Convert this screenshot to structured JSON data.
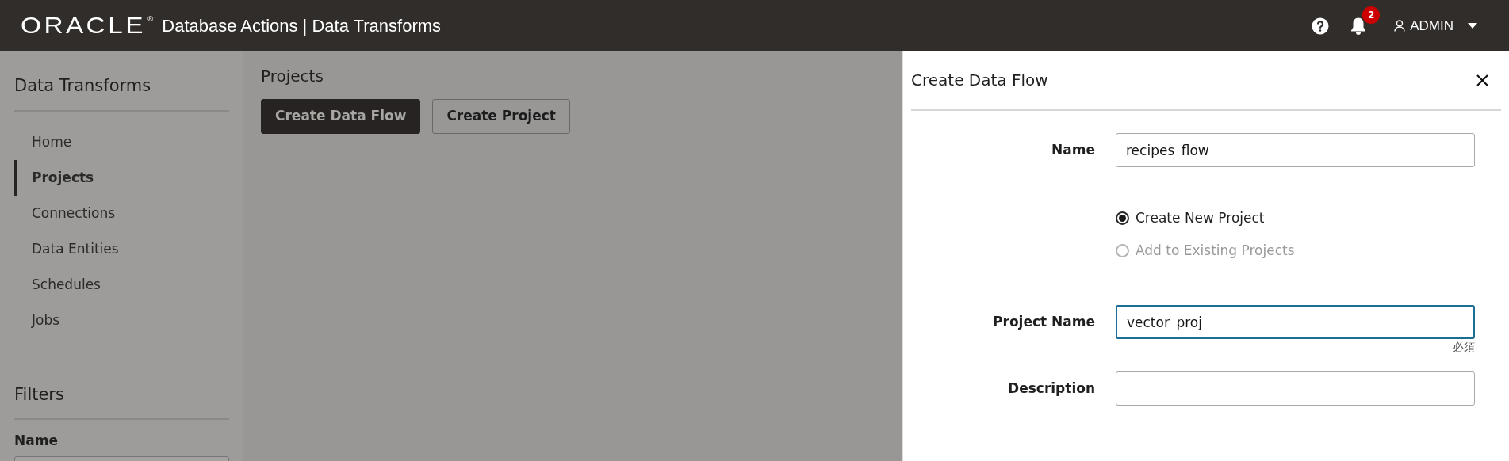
{
  "header": {
    "logo": "ORACLE",
    "logo_mark": "®",
    "title": "Database Actions | Data Transforms",
    "notification_count": "2",
    "user": "ADMIN"
  },
  "sidebar": {
    "title": "Data Transforms",
    "items": [
      {
        "label": "Home",
        "selected": false
      },
      {
        "label": "Projects",
        "selected": true
      },
      {
        "label": "Connections",
        "selected": false
      },
      {
        "label": "Data Entities",
        "selected": false
      },
      {
        "label": "Schedules",
        "selected": false
      },
      {
        "label": "Jobs",
        "selected": false
      }
    ],
    "filters_title": "Filters",
    "filter_label": "Name"
  },
  "main": {
    "title": "Projects",
    "buttons": [
      {
        "label": "Create Data Flow",
        "kind": "primary"
      },
      {
        "label": "Create Project",
        "kind": "secondary"
      }
    ]
  },
  "dialog": {
    "title": "Create Data Flow",
    "name": {
      "label": "Name",
      "value": "recipes_flow"
    },
    "options": [
      {
        "label": "Create New Project",
        "selected": true,
        "disabled": false
      },
      {
        "label": "Add to Existing Projects",
        "selected": false,
        "disabled": true
      }
    ],
    "project_name": {
      "label": "Project Name",
      "value": "vector_proj",
      "focused": true,
      "hint": "必須"
    },
    "description": {
      "label": "Description"
    }
  }
}
